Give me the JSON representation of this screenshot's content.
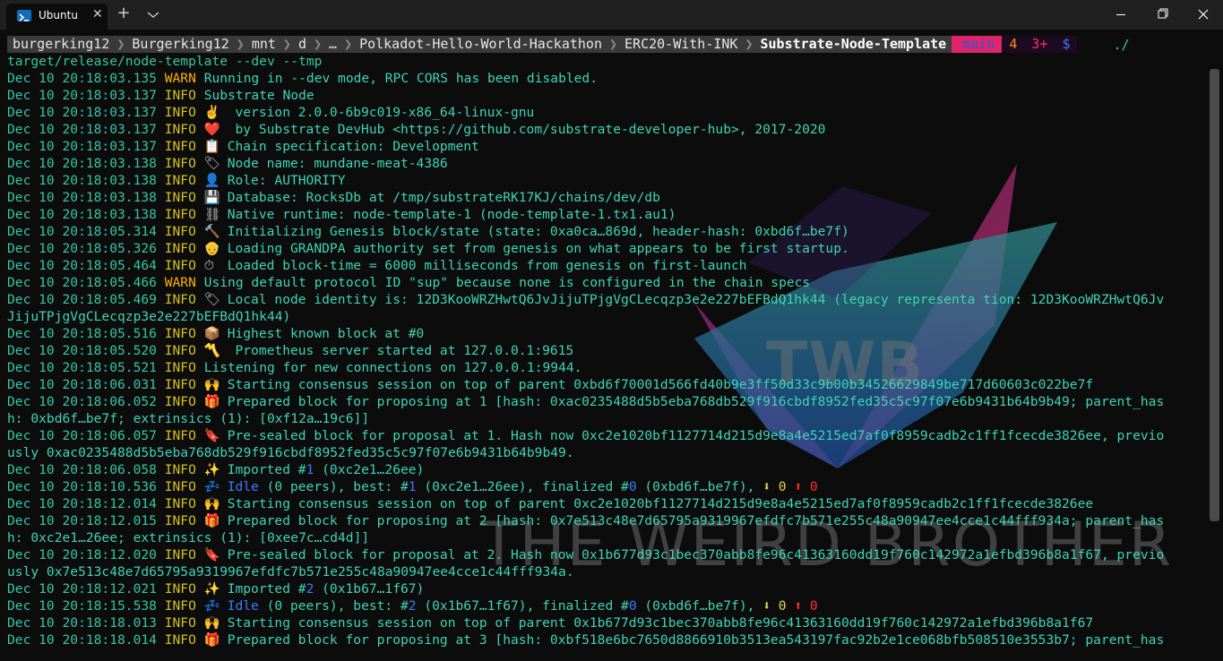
{
  "tab": {
    "title": "Ubuntu",
    "close": "✕"
  },
  "titlebar": {
    "new_tab": "+"
  },
  "prompt": {
    "segments": [
      "burgerking12",
      "Burgerking12",
      "mnt",
      "d",
      "…",
      "Polkadot-Hello-World-Hackathon",
      "ERC20-With-INK",
      "Substrate-Node-Template"
    ],
    "git_branch": " main",
    "git_stash": "4",
    "git_changes": "3+",
    "dollar": "$",
    "cwd_cmd": "./",
    "command": "target/release/node-template --dev --tmp"
  },
  "log": [
    {
      "ts": "Dec 10 20:18:03.135",
      "lvl": "WARN",
      "msg": "Running in --dev mode, RPC CORS has been disabled."
    },
    {
      "ts": "Dec 10 20:18:03.137",
      "lvl": "INFO",
      "msg": "Substrate Node"
    },
    {
      "ts": "Dec 10 20:18:03.137",
      "lvl": "INFO",
      "emo": "✌️",
      "msg": " version 2.0.0-6b9c019-x86_64-linux-gnu"
    },
    {
      "ts": "Dec 10 20:18:03.137",
      "lvl": "INFO",
      "emo": "❤️",
      "msg": " by Substrate DevHub <https://github.com/substrate-developer-hub>, 2017-2020"
    },
    {
      "ts": "Dec 10 20:18:03.137",
      "lvl": "INFO",
      "emo": "📋",
      "msg": "Chain specification: Development"
    },
    {
      "ts": "Dec 10 20:18:03.138",
      "lvl": "INFO",
      "emo": "🏷",
      "msg": "Node name: mundane-meat-4386"
    },
    {
      "ts": "Dec 10 20:18:03.138",
      "lvl": "INFO",
      "emo": "👤",
      "msg": "Role: AUTHORITY"
    },
    {
      "ts": "Dec 10 20:18:03.138",
      "lvl": "INFO",
      "emo": "💾",
      "msg": "Database: RocksDb at /tmp/substrateRK17KJ/chains/dev/db"
    },
    {
      "ts": "Dec 10 20:18:03.138",
      "lvl": "INFO",
      "emo": "⛓",
      "msg": "Native runtime: node-template-1 (node-template-1.tx1.au1)"
    },
    {
      "ts": "Dec 10 20:18:05.314",
      "lvl": "INFO",
      "emo": "🔨",
      "msg": "Initializing Genesis block/state (state: 0xa0ca…869d, header-hash: 0xbd6f…be7f)"
    },
    {
      "ts": "Dec 10 20:18:05.326",
      "lvl": "INFO",
      "emo": "👴",
      "msg": "Loading GRANDPA authority set from genesis on what appears to be first startup."
    },
    {
      "ts": "Dec 10 20:18:05.464",
      "lvl": "INFO",
      "emo": "⏱",
      "msg": "Loaded block-time = 6000 milliseconds from genesis on first-launch"
    },
    {
      "ts": "Dec 10 20:18:05.466",
      "lvl": "WARN",
      "msg": "Using default protocol ID \"sup\" because none is configured in the chain specs"
    },
    {
      "ts": "Dec 10 20:18:05.469",
      "lvl": "INFO",
      "emo": "🏷",
      "msg": "Local node identity is: 12D3KooWRZHwtQ6JvJijuTPjgVgCLecqzp3e2e227bEFBdQ1hk44 (legacy representa tion: 12D3KooWRZHwtQ6Jv"
    },
    {
      "ts": "",
      "lvl": "",
      "msg": "JijuTPjgVgCLecqzp3e2e227bEFBdQ1hk44)"
    },
    {
      "ts": "Dec 10 20:18:05.516",
      "lvl": "INFO",
      "emo": "📦",
      "msg": "Highest known block at #0"
    },
    {
      "ts": "Dec 10 20:18:05.520",
      "lvl": "INFO",
      "emo": "〽️",
      "msg": " Prometheus server started at 127.0.0.1:9615"
    },
    {
      "ts": "Dec 10 20:18:05.521",
      "lvl": "INFO",
      "msg": "Listening for new connections on 127.0.0.1:9944."
    },
    {
      "ts": "Dec 10 20:18:06.031",
      "lvl": "INFO",
      "emo": "🙌",
      "msg": "Starting consensus session on top of parent 0xbd6f70001d566fd40b9e3ff50d33c9b00b34526629849be717d60603c022be7f"
    },
    {
      "ts": "Dec 10 20:18:06.052",
      "lvl": "INFO",
      "emo": "🎁",
      "msg": "Prepared block for proposing at 1 [hash: 0xac0235488d5b5eba768db529f916cbdf8952fed35c5c97f07e6b9431b64b9b49; parent_has"
    },
    {
      "ts": "",
      "lvl": "",
      "msg": "h: 0xbd6f…be7f; extrinsics (1): [0xf12a…19c6]]"
    },
    {
      "ts": "Dec 10 20:18:06.057",
      "lvl": "INFO",
      "emo": "🔖",
      "msg": "Pre-sealed block for proposal at 1. Hash now 0xc2e1020bf1127714d215d9e8a4e5215ed7af0f8959cadb2c1ff1fcecde3826ee, previo"
    },
    {
      "ts": "",
      "lvl": "",
      "msg": "usly 0xac0235488d5b5eba768db529f916cbdf8952fed35c5c97f07e6b9431b64b9b49."
    },
    {
      "ts": "Dec 10 20:18:06.058",
      "lvl": "INFO",
      "emo": "✨",
      "msg": "Imported #1 (0xc2e1…26ee)",
      "kind": "imported",
      "num": "1"
    },
    {
      "ts": "Dec 10 20:18:10.536",
      "lvl": "INFO",
      "emo": "💤",
      "kind": "idle",
      "best": "1",
      "besthash": "(0xc2e1…26ee)",
      "fin": "0",
      "finhash": "(0xbd6f…be7f)"
    },
    {
      "ts": "Dec 10 20:18:12.014",
      "lvl": "INFO",
      "emo": "🙌",
      "msg": "Starting consensus session on top of parent 0xc2e1020bf1127714d215d9e8a4e5215ed7af0f8959cadb2c1ff1fcecde3826ee"
    },
    {
      "ts": "Dec 10 20:18:12.015",
      "lvl": "INFO",
      "emo": "🎁",
      "msg": "Prepared block for proposing at 2 [hash: 0x7e513c48e7d65795a9319967efdfc7b571e255c48a90947ee4cce1c44fff934a; parent_has"
    },
    {
      "ts": "",
      "lvl": "",
      "msg": "h: 0xc2e1…26ee; extrinsics (1): [0xee7c…cd4d]]"
    },
    {
      "ts": "Dec 10 20:18:12.020",
      "lvl": "INFO",
      "emo": "🔖",
      "msg": "Pre-sealed block for proposal at 2. Hash now 0x1b677d93c1bec370abb8fe96c41363160dd19f760c142972a1efbd396b8a1f67, previo"
    },
    {
      "ts": "",
      "lvl": "",
      "msg": "usly 0x7e513c48e7d65795a9319967efdfc7b571e255c48a90947ee4cce1c44fff934a."
    },
    {
      "ts": "Dec 10 20:18:12.021",
      "lvl": "INFO",
      "emo": "✨",
      "msg": "Imported #2 (0x1b67…1f67)",
      "kind": "imported",
      "num": "2"
    },
    {
      "ts": "Dec 10 20:18:15.538",
      "lvl": "INFO",
      "emo": "💤",
      "kind": "idle",
      "best": "2",
      "besthash": "(0x1b67…1f67)",
      "fin": "0",
      "finhash": "(0xbd6f…be7f)"
    },
    {
      "ts": "Dec 10 20:18:18.013",
      "lvl": "INFO",
      "emo": "🙌",
      "msg": "Starting consensus session on top of parent 0x1b677d93c1bec370abb8fe96c41363160dd19f760c142972a1efbd396b8a1f67"
    },
    {
      "ts": "Dec 10 20:18:18.014",
      "lvl": "INFO",
      "emo": "🎁",
      "msg": "Prepared block for proposing at 3 [hash: 0xbf518e6bc7650d8866910b3513ea543197fac92b2e1ce068bfb508510e3553b7; parent_has"
    }
  ],
  "watermark": {
    "logo_text": "TWB",
    "name": "THE WEIRD BROTHER"
  },
  "colors": {
    "timestamp": "#35c7a5",
    "info": "#d6c21a",
    "warn": "#ffb000",
    "message": "#3ed4b7",
    "idle": "#3a7bff",
    "red": "#ff3333"
  }
}
